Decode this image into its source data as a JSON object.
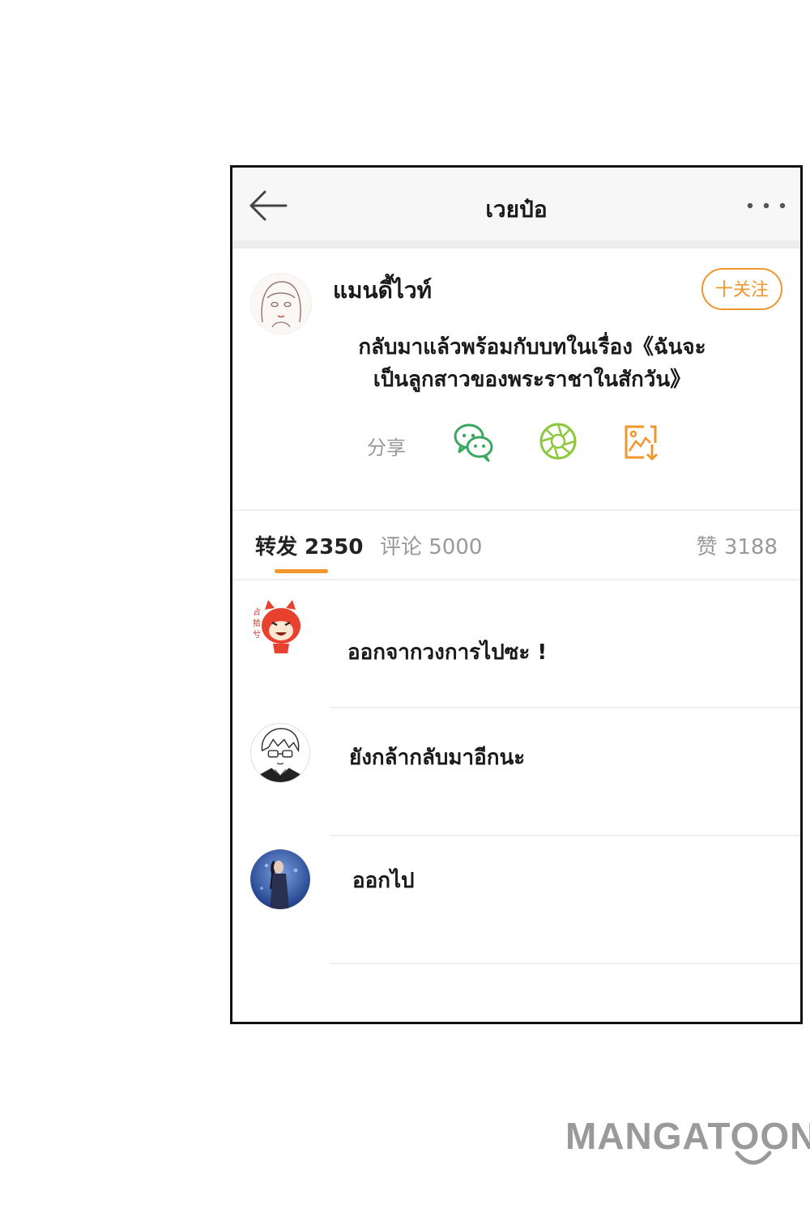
{
  "header": {
    "title": "เวยป๋อ"
  },
  "post": {
    "author": "แมนดี้ไวท์",
    "follow_label": "十关注",
    "text_line1": "กลับมาแล้วพร้อมกับบทในเรื่อง《ฉันจะ",
    "text_line2": "เป็นลูกสาวของพระราชาในสักวัน》",
    "share_label": "分享"
  },
  "tabs": [
    {
      "label": "转发 2350",
      "active": true
    },
    {
      "label": "评论 5000",
      "active": false
    },
    {
      "label": "赞 3188",
      "active": false
    }
  ],
  "comments": [
    {
      "text": "ออกจากวงการไปซะ !",
      "avatar": "red-cartoon-fox-avatar"
    },
    {
      "text": "ยังกล้ากลับมาอีกนะ",
      "avatar": "manga-boy-glasses-avatar"
    },
    {
      "text": "ออกไป",
      "avatar": "woman-blue-background-avatar"
    }
  ],
  "colors": {
    "accent": "#f0962e",
    "wechat": "#3aa760",
    "moments": "#8cc83c",
    "save": "#f0962e"
  },
  "watermark": "MANGATOON"
}
